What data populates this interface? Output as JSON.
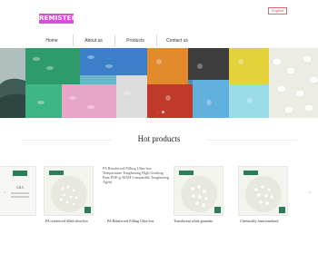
{
  "header": {
    "logo_text": "REMISTER",
    "lang_button": "English"
  },
  "nav": {
    "items": [
      {
        "label": "Home"
      },
      {
        "label": "About us"
      },
      {
        "label": "Products"
      },
      {
        "label": "Contact us"
      }
    ]
  },
  "banner": {
    "slides": 2,
    "active_index": 0
  },
  "hot_products": {
    "title": "Hot products",
    "items": [
      {
        "caption": "PA reinforced filled ultra-low"
      },
      {
        "caption": "PA Reinforced Filling Ultra-low"
      },
      {
        "caption": "Translucent white granules"
      },
      {
        "caption": "Chemically functionalized"
      }
    ],
    "broken_image_alt": "PA Reinforced Filling Ultra-low Temperature Toughening High Grafting Rate POE-g-MAH Compatible Toughening Agent",
    "left_fragment": "GRA"
  },
  "colors": {
    "logo_bg": "#d94fd4",
    "lang_border": "#e06a6a",
    "dot_active": "#e03a3a",
    "dot_inactive": "#ffffff"
  }
}
